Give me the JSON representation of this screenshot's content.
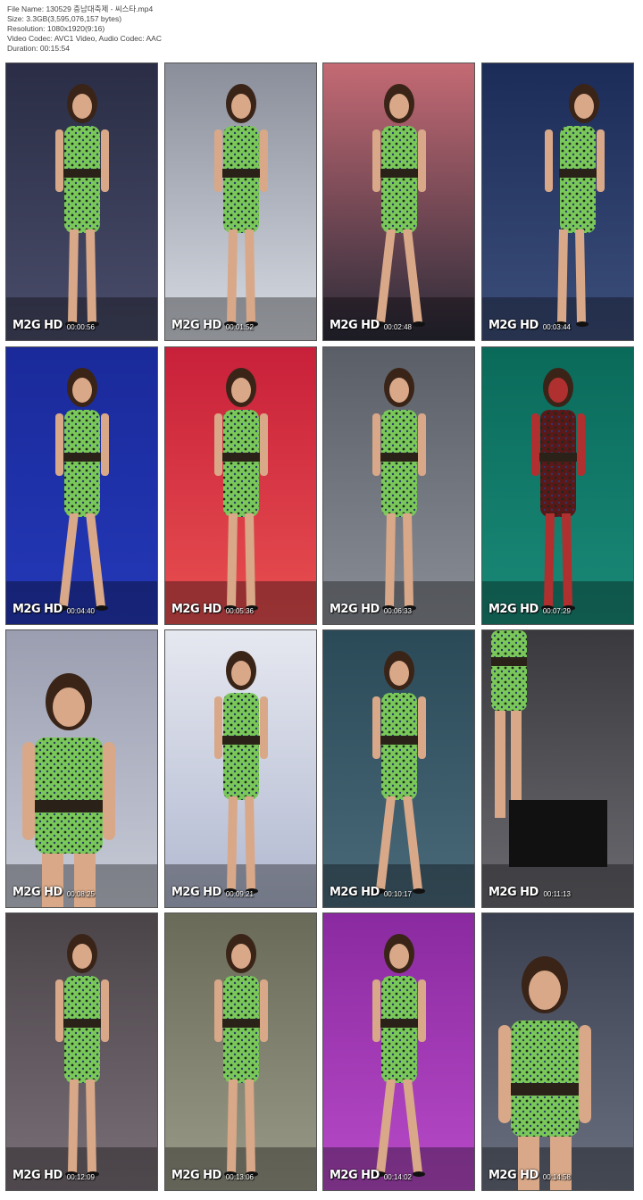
{
  "info": {
    "file_name": "File Name: 130529 충남대축제 - 씨스타.mp4",
    "size": "Size: 3.3GB(3,595,076,157 bytes)",
    "resolution": "Resolution: 1080x1920(9:16)",
    "codec": "Video Codec: AVC1 Video, Audio Codec: AAC",
    "duration": "Duration: 00:15:54"
  },
  "logo_text": "M2G HD",
  "thumbnails": [
    {
      "time": "00:00:56",
      "bg": [
        "#2a2d45",
        "#4a4d6a"
      ],
      "pose": "singer"
    },
    {
      "time": "00:01:52",
      "bg": [
        "#8a8e9a",
        "#d8dce4"
      ],
      "pose": "singer"
    },
    {
      "time": "00:02:48",
      "bg": [
        "#c46a74",
        "#2a2a38"
      ],
      "pose": "dancer"
    },
    {
      "time": "00:03:44",
      "bg": [
        "#1c2c58",
        "#3c4e7a"
      ],
      "pose": "lean"
    },
    {
      "time": "00:04:40",
      "bg": [
        "#1a2a9a",
        "#2438b8"
      ],
      "pose": "dancer"
    },
    {
      "time": "00:05:36",
      "bg": [
        "#c8203a",
        "#e85050"
      ],
      "pose": "singer"
    },
    {
      "time": "00:06:33",
      "bg": [
        "#5a5e66",
        "#8a8e96"
      ],
      "pose": "singer"
    },
    {
      "time": "00:07:29",
      "bg": [
        "#0a6a5a",
        "#1a8a78"
      ],
      "pose": "red"
    },
    {
      "time": "00:08:25",
      "bg": [
        "#9a9eb0",
        "#c8ccd8"
      ],
      "pose": "close"
    },
    {
      "time": "00:09:21",
      "bg": [
        "#e6e8f0",
        "#b0b8d0"
      ],
      "pose": "singer"
    },
    {
      "time": "00:10:17",
      "bg": [
        "#2a4a58",
        "#4a6a7a"
      ],
      "pose": "dancer"
    },
    {
      "time": "00:11:13",
      "bg": [
        "#3a3a3e",
        "#6a6a70"
      ],
      "pose": "partial"
    },
    {
      "time": "00:12:09",
      "bg": [
        "#4a4448",
        "#7a7078"
      ],
      "pose": "singer"
    },
    {
      "time": "00:13:06",
      "bg": [
        "#6a6a58",
        "#9a9a88"
      ],
      "pose": "singer"
    },
    {
      "time": "00:14:02",
      "bg": [
        "#8a2aa0",
        "#b84ac8"
      ],
      "pose": "dancer"
    },
    {
      "time": "00:14:58",
      "bg": [
        "#3a4050",
        "#6a7080"
      ],
      "pose": "close"
    }
  ]
}
